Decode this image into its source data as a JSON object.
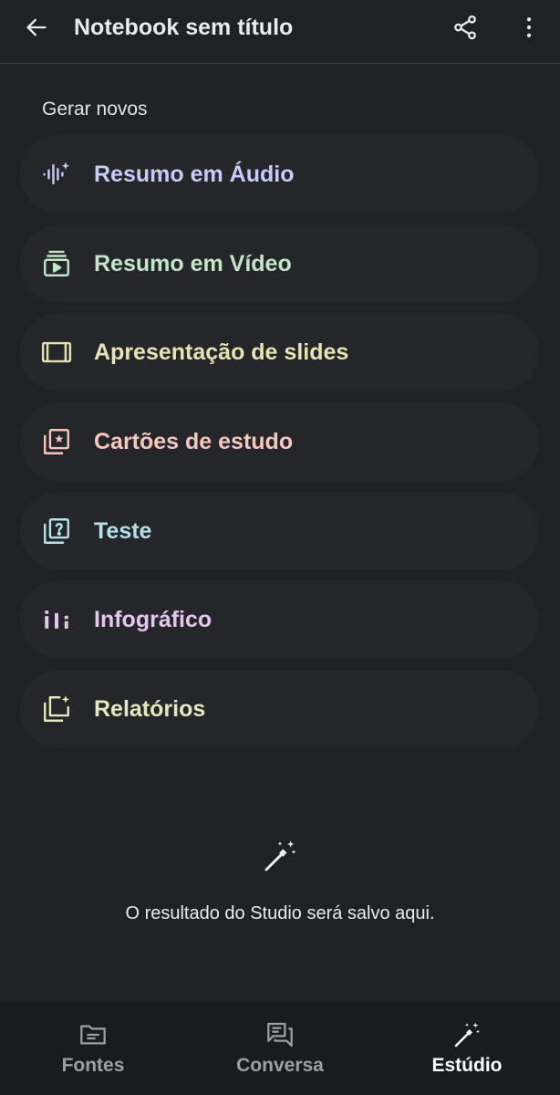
{
  "header": {
    "title": "Notebook sem título",
    "back_icon": "arrow-left-icon",
    "share_icon": "share-icon",
    "more_icon": "more-vert-icon"
  },
  "section": {
    "label": "Gerar novos"
  },
  "items": [
    {
      "label": "Resumo em Áudio",
      "icon": "audio-waveform-icon",
      "color": "#c6cdf7"
    },
    {
      "label": "Resumo em Vídeo",
      "icon": "video-summary-icon",
      "color": "#c3e6c9"
    },
    {
      "label": "Apresentação de slides",
      "icon": "slides-icon",
      "color": "#e8e3b4"
    },
    {
      "label": "Cartões de estudo",
      "icon": "flashcards-icon",
      "color": "#f4c8bf"
    },
    {
      "label": "Teste",
      "icon": "quiz-icon",
      "color": "#b6e1e8"
    },
    {
      "label": "Infográfico",
      "icon": "infographic-icon",
      "color": "#e4c6ee"
    },
    {
      "label": "Relatórios",
      "icon": "reports-icon",
      "color": "#e6e7bf"
    }
  ],
  "empty_state": {
    "icon": "magic-wand-icon",
    "message": "O resultado do Studio será salvo aqui."
  },
  "bottom_nav": [
    {
      "label": "Fontes",
      "icon": "folder-icon",
      "active": false
    },
    {
      "label": "Conversa",
      "icon": "chat-icon",
      "active": false
    },
    {
      "label": "Estúdio",
      "icon": "magic-wand-icon",
      "active": true
    }
  ],
  "colors": {
    "background": "#202124",
    "item_background": "#242629",
    "bottom_nav_background": "#1a1b1e",
    "text_primary": "#e8eaed",
    "text_inactive": "#9aa0a6"
  }
}
